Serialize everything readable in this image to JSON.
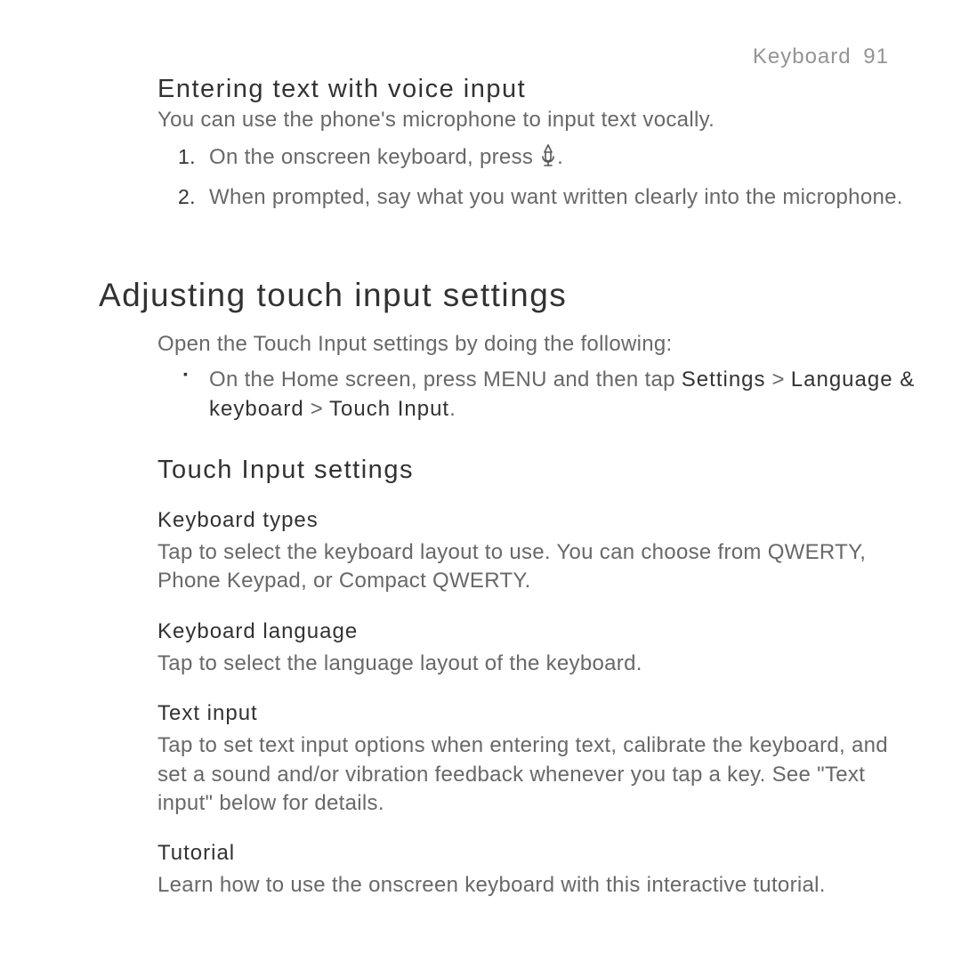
{
  "header": {
    "section": "Keyboard",
    "page_number": "91"
  },
  "voice": {
    "title": "Entering text with voice input",
    "intro": "You can use the phone's microphone to input text vocally.",
    "step1_a": "On the onscreen keyboard, press ",
    "step1_b": ".",
    "step2": "When prompted, say what you want written clearly into the microphone."
  },
  "adjust": {
    "title": "Adjusting touch input settings",
    "intro": "Open the Touch Input settings by doing the following:",
    "bullet_a": "On the Home screen, press MENU and then tap ",
    "settings_label": "Settings",
    "sep1": " > ",
    "lang_kb_label": "Language & keyboard",
    "sep2": " > ",
    "touch_input_label": "Touch Input",
    "bullet_end": "."
  },
  "touch_settings": {
    "title": "Touch Input settings",
    "kt_h": "Keyboard types",
    "kt_b": "Tap to select the keyboard layout to use. You can choose from QWERTY, Phone Keypad, or Compact QWERTY.",
    "kl_h": "Keyboard language",
    "kl_b": "Tap to select the language layout of the keyboard.",
    "ti_h": "Text input",
    "ti_b": "Tap to set text input options when entering text, calibrate the keyboard, and set a sound and/or vibration feedback whenever you tap a key. See \"Text input\" below for details.",
    "tut_h": "Tutorial",
    "tut_b": "Learn how to use the onscreen keyboard with this interactive tutorial."
  }
}
